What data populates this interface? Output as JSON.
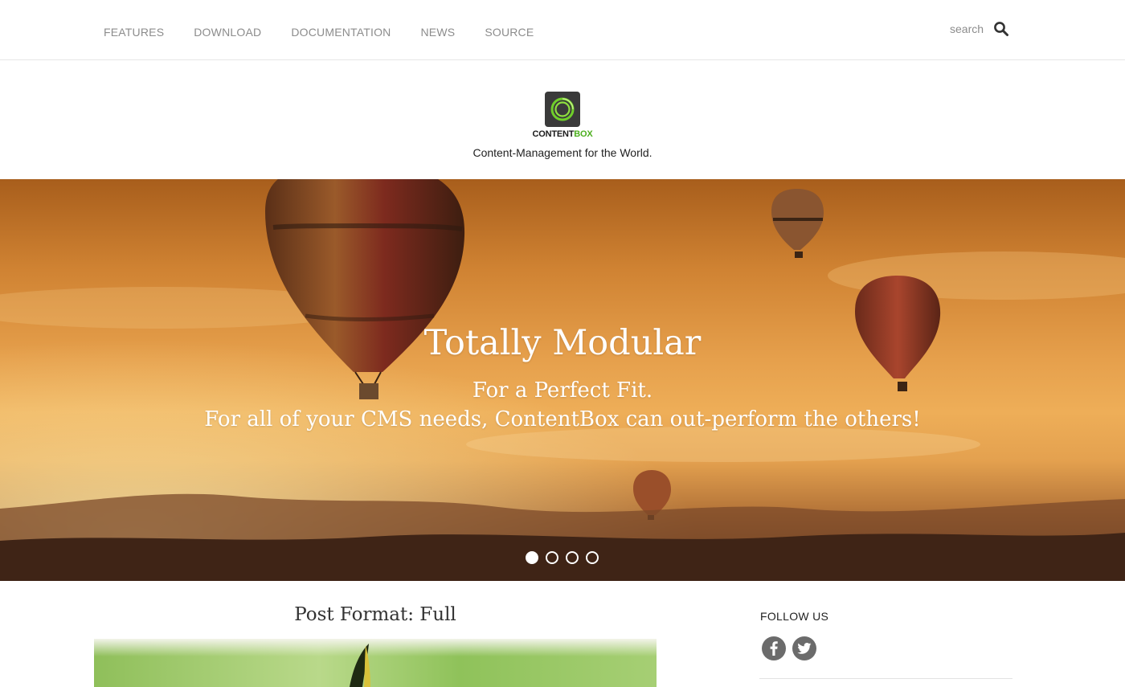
{
  "nav": {
    "items": [
      {
        "label": "FEATURES"
      },
      {
        "label": "DOWNLOAD"
      },
      {
        "label": "DOCUMENTATION"
      },
      {
        "label": "NEWS"
      },
      {
        "label": "SOURCE"
      }
    ]
  },
  "search": {
    "placeholder": "search",
    "icon": "search-icon"
  },
  "brand": {
    "logo_text_1": "CONTENT",
    "logo_text_2": "BOX",
    "tagline": "Content-Management for the World.",
    "accent_color": "#4caf1e"
  },
  "hero": {
    "title": "Totally Modular",
    "subtitle_1": "For a Perfect Fit.",
    "subtitle_2": "For all of your CMS needs, ContentBox can out-perform the others!",
    "slides_total": 4,
    "active_slide": 1
  },
  "post": {
    "title": "Post Format: Full"
  },
  "sidebar": {
    "follow_title": "FOLLOW US",
    "social": [
      {
        "icon": "facebook-icon"
      },
      {
        "icon": "twitter-icon"
      }
    ]
  }
}
